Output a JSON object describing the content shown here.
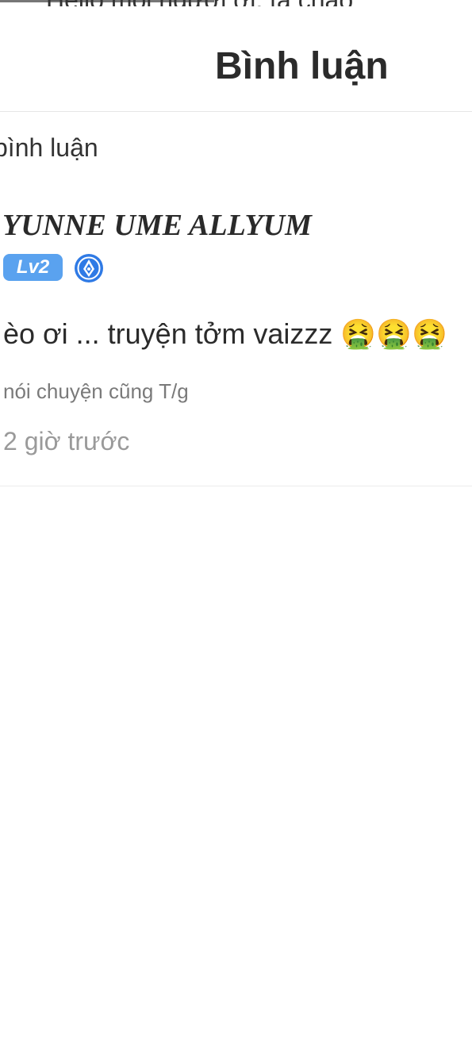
{
  "top": {
    "peek_text": "Hello mọi người ơi, ta chào"
  },
  "header": {
    "title": "Bình luận"
  },
  "comments_section": {
    "label": "bình luận"
  },
  "comment": {
    "username": "YUNNE UME ALLYUM",
    "level_badge": "Lv2",
    "author_badge_icon": "pen-nib-icon",
    "text": "èo ơi ... truyện tởm vaizzz 🤮🤮🤮",
    "reply_preview": "nói chuyện cũng T/g",
    "timestamp": "2 giờ trước"
  },
  "colors": {
    "badge_blue": "#5aa2ef",
    "pen_blue": "#2f7ae5",
    "divider": "#e6e6e6"
  }
}
